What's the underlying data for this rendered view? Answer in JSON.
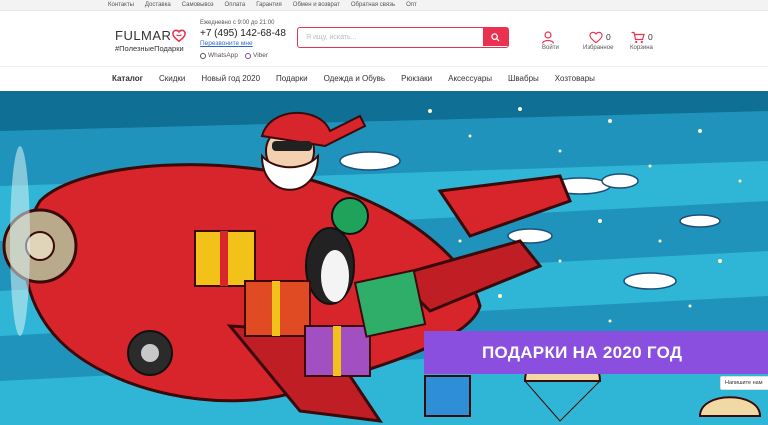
{
  "topbar": {
    "links": [
      "Контакты",
      "Доставка",
      "Самовывоз",
      "Оплата",
      "Гарантия",
      "Обмен и возврат",
      "Обратная связь",
      "Опт"
    ]
  },
  "logo": {
    "wordmark": "FULMAR",
    "tagline": "#ПолезныеПодарки"
  },
  "contact": {
    "hours": "Ежедневно с 9:00 до 21:00",
    "phone": "+7 (495) 142-68-48",
    "callback": "Перезвоните мне",
    "whatsapp": "WhatsApp",
    "viber": "Viber"
  },
  "search": {
    "placeholder": "Я ищу, искать..."
  },
  "user_icons": {
    "login_label": "Войти",
    "favorites_label": "Избранное",
    "favorites_count": "0",
    "cart_label": "Корзина",
    "cart_count": "0"
  },
  "nav": {
    "items": [
      "Каталог",
      "Скидки",
      "Новый год 2020",
      "Подарки",
      "Одежда и Обувь",
      "Рюкзаки",
      "Аксессуары",
      "Швабры",
      "Хозтовары"
    ]
  },
  "hero": {
    "promo_text": "ПОДАРКИ НА 2020 ГОД",
    "chat_text": "Напишите нам"
  },
  "colors": {
    "accent": "#e8324f",
    "promo": "#8b4fe0",
    "sky": "#2fb6d6",
    "link": "#2d6ac8"
  }
}
